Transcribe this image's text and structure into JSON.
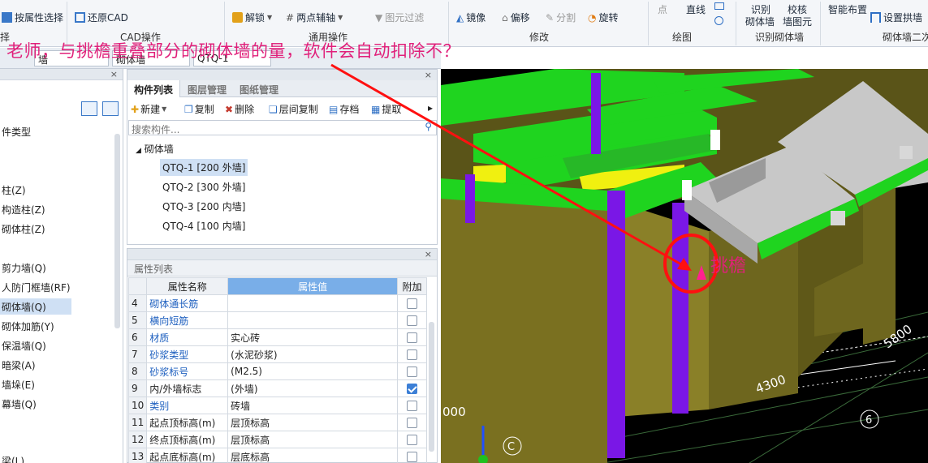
{
  "ribbon": {
    "row1": [
      "按属性选择",
      "还原CAD",
      "解锁",
      "两点辅轴",
      "图元过滤",
      "镜像",
      "偏移",
      "分割",
      "旋转",
      "直线",
      "识别",
      "校核",
      "智能布置",
      "设置拱墙"
    ],
    "row1b": [
      "砌体墙",
      "墙图元",
      "点"
    ],
    "groups": [
      "择",
      "CAD操作",
      "通用操作",
      "修改",
      "绘图",
      "识别砌体墙",
      "砌体墙二次"
    ]
  },
  "question": "老师，与挑檐重叠部分的砌体墙的量，软件会自动扣除不？",
  "subbar": {
    "combo1": "墙",
    "combo2": "砌体墙",
    "combo3": "QTQ-1"
  },
  "nav": {
    "items": [
      "件类型",
      "柱(Z)",
      "构造柱(Z)",
      "砌体柱(Z)",
      "剪力墙(Q)",
      "人防门框墙(RF)",
      "砌体墙(Q)",
      "砌体加筋(Y)",
      "保温墙(Q)",
      "暗梁(A)",
      "墙垛(E)",
      "幕墙(Q)",
      "梁(L)"
    ]
  },
  "complist": {
    "tabs": [
      "构件列表",
      "图层管理",
      "图纸管理"
    ],
    "tools": [
      "新建",
      "复制",
      "删除",
      "层间复制",
      "存档",
      "提取"
    ],
    "search_placeholder": "搜索构件...",
    "root": "砌体墙",
    "items": [
      "QTQ-1 [200 外墙]",
      "QTQ-2 [300 外墙]",
      "QTQ-3 [200 内墙]",
      "QTQ-4 [100 内墙]"
    ]
  },
  "proplist": {
    "title": "属性列表",
    "headers": [
      "属性名称",
      "属性值",
      "附加"
    ],
    "rows": [
      {
        "n": "4",
        "name": "砌体通长筋",
        "value": "",
        "checked": false,
        "blue": true
      },
      {
        "n": "5",
        "name": "横向短筋",
        "value": "",
        "checked": false,
        "blue": true
      },
      {
        "n": "6",
        "name": "材质",
        "value": "实心砖",
        "checked": false,
        "blue": true
      },
      {
        "n": "7",
        "name": "砂浆类型",
        "value": "(水泥砂浆)",
        "checked": false,
        "blue": true
      },
      {
        "n": "8",
        "name": "砂浆标号",
        "value": "(M2.5)",
        "checked": false,
        "blue": true
      },
      {
        "n": "9",
        "name": "内/外墙标志",
        "value": "(外墙)",
        "checked": true,
        "blue": false
      },
      {
        "n": "10",
        "name": "类别",
        "value": "砖墙",
        "checked": false,
        "blue": true
      },
      {
        "n": "11",
        "name": "起点顶标高(m)",
        "value": "层顶标高",
        "checked": false,
        "blue": false
      },
      {
        "n": "12",
        "name": "终点顶标高(m)",
        "value": "层顶标高",
        "checked": false,
        "blue": false
      },
      {
        "n": "13",
        "name": "起点底标高(m)",
        "value": "层底标高",
        "checked": false,
        "blue": false
      }
    ]
  },
  "viewport": {
    "label": "挑檐",
    "dims": [
      "4300",
      "5800",
      "000",
      "C",
      "6"
    ]
  },
  "colors": {
    "accent": "#e0207a",
    "wall": "#7a7020",
    "beam": "#1fd41f",
    "column": "#7a17e6",
    "roof": "#c8c8c8"
  }
}
